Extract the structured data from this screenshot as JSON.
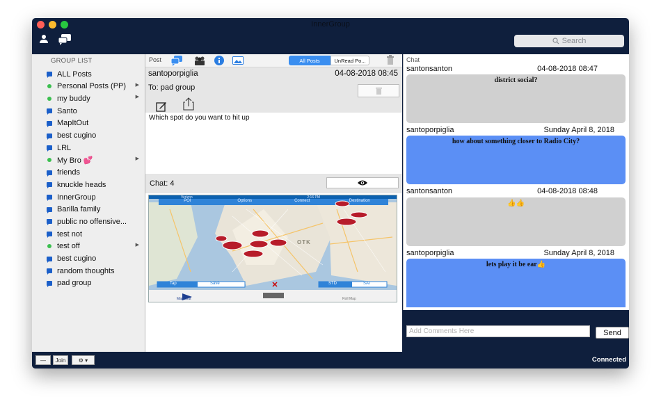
{
  "window": {
    "title": "InnerGroup"
  },
  "toolbar": {
    "search_placeholder": "Search"
  },
  "sidebar": {
    "header": "GROUP LIST",
    "items": [
      {
        "label": "ALL Posts",
        "icon": "flag-icon"
      },
      {
        "label": "Personal Posts (PP)",
        "icon": "online-dot-icon",
        "has_arrow": true
      },
      {
        "label": "my buddy",
        "icon": "online-dot-icon",
        "has_arrow": true
      },
      {
        "label": "Santo",
        "icon": "flag-icon"
      },
      {
        "label": "MapItOut",
        "icon": "flag-icon"
      },
      {
        "label": "best cugino",
        "icon": "flag-icon"
      },
      {
        "label": "LRL",
        "icon": "flag-icon"
      },
      {
        "label": "My Bro 💕",
        "icon": "online-dot-icon",
        "has_arrow": true
      },
      {
        "label": "friends",
        "icon": "flag-icon"
      },
      {
        "label": "knuckle heads",
        "icon": "flag-icon"
      },
      {
        "label": "InnerGroup",
        "icon": "flag-icon"
      },
      {
        "label": "Barilla family",
        "icon": "flag-icon"
      },
      {
        "label": "public no offensive...",
        "icon": "flag-icon"
      },
      {
        "label": "test not",
        "icon": "flag-icon"
      },
      {
        "label": "test off",
        "icon": "online-dot-icon",
        "has_arrow": true
      },
      {
        "label": "best cugino",
        "icon": "flag-icon"
      },
      {
        "label": "random thoughts",
        "icon": "flag-icon"
      },
      {
        "label": "pad group",
        "icon": "flag-icon"
      }
    ]
  },
  "bottom_bar": {
    "remove_label": "—",
    "join_label": "Join",
    "gear_label": "⚙ ▾",
    "status": "Connected"
  },
  "post": {
    "label": "Post",
    "filter_all": "All Posts",
    "filter_unread": "UnRead Po...",
    "author": "santoporpiglia",
    "date": "04-08-2018 08:45",
    "to": "To: pad group",
    "body": "Which spot do you want to hit up",
    "chat_count_label": "Chat:  4"
  },
  "map": {
    "tabs": [
      "POI",
      "Options",
      "Connect",
      "Destination"
    ],
    "bottom_tabs": [
      "Tap",
      "Save",
      "STD",
      "SAT"
    ],
    "footer": [
      "MapItOut",
      "Roll Map"
    ],
    "status_left": "Verizon",
    "status_time": "2:16 PM",
    "label": "OTK"
  },
  "chat": {
    "header": "Chat",
    "messages": [
      {
        "author": "santonsanton",
        "date": "04-08-2018 08:47",
        "text": "district social?",
        "style": "gray"
      },
      {
        "author": "santoporpiglia",
        "date": "Sunday April 8, 2018",
        "text": "how about something closer to Radio City?",
        "style": "blue"
      },
      {
        "author": "santonsanton",
        "date": "04-08-2018 08:48",
        "text": "👍👍",
        "style": "gray"
      },
      {
        "author": "santoporpiglia",
        "date": "Sunday April 8, 2018",
        "text": "lets play it be ear👍",
        "style": "blue"
      }
    ],
    "compose_placeholder": "Add Comments Here",
    "send_label": "Send"
  },
  "colors": {
    "window_bg": "#0f1f3d",
    "bubble_gray": "#d0d0d0",
    "bubble_blue": "#5b8ff5",
    "segment_active": "#3a8ef0"
  }
}
